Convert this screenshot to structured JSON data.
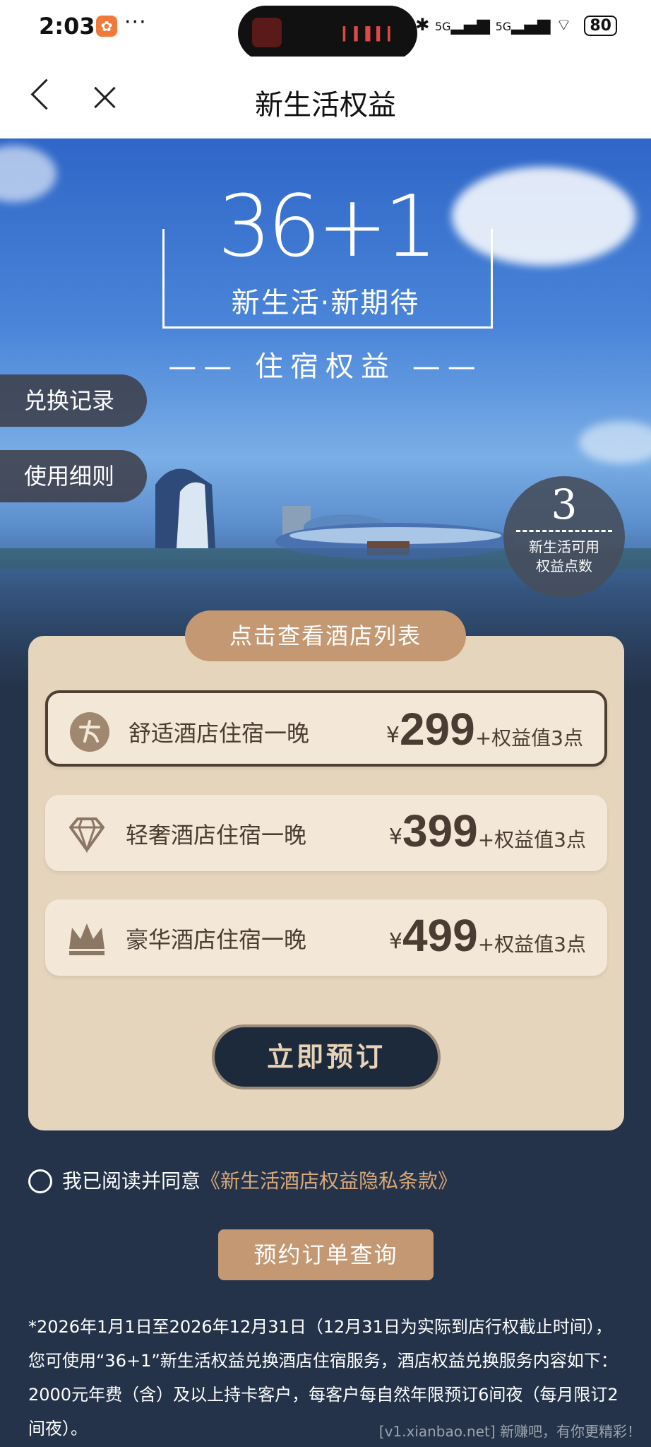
{
  "status_bar": {
    "time": "2:03",
    "battery": "80",
    "more": "···"
  },
  "nav": {
    "title": "新生活权益"
  },
  "hero": {
    "logo_number": "36+1",
    "logo_slogan": "新生活·新期待",
    "logo_tag": "—— 住宿权益 ——",
    "exchange_record": "兑换记录",
    "usage_rules": "使用细则",
    "points_value": "3",
    "points_label_line1": "新生活可用",
    "points_label_line2": "权益点数"
  },
  "panel": {
    "hotel_list_button": "点击查看酒店列表",
    "options": [
      {
        "label": "舒适酒店住宿一晚",
        "currency": "¥",
        "price": "299",
        "extra": "+权益值3点",
        "icon": "comfort-hotel-icon"
      },
      {
        "label": "轻奢酒店住宿一晚",
        "currency": "¥",
        "price": "399",
        "extra": "+权益值3点",
        "icon": "diamond-icon"
      },
      {
        "label": "豪华酒店住宿一晚",
        "currency": "¥",
        "price": "499",
        "extra": "+权益值3点",
        "icon": "crown-icon"
      }
    ],
    "book_button": "立即预订"
  },
  "agreement": {
    "prefix": "我已阅读并同意",
    "link": "《新生活酒店权益隐私条款》"
  },
  "query_button": "预约订单查询",
  "notice": "*2026年1月1日至2026年12月31日（12月31日为实际到店行权截止时间），您可使用“36+1”新生活权益兑换酒店住宿服务，酒店权益兑换服务内容如下：2000元年费（含）及以上持卡客户，每客户每自然年限预订6间夜（每月限订2间夜）。",
  "watermark": "[v1.xianbao.net] 新赚吧，有你更精彩！",
  "colors": {
    "accent_gold": "#c49872",
    "dark_navy": "#1c2a3c",
    "panel_beige": "#e6d5bd",
    "link_gold": "#d9a877"
  }
}
